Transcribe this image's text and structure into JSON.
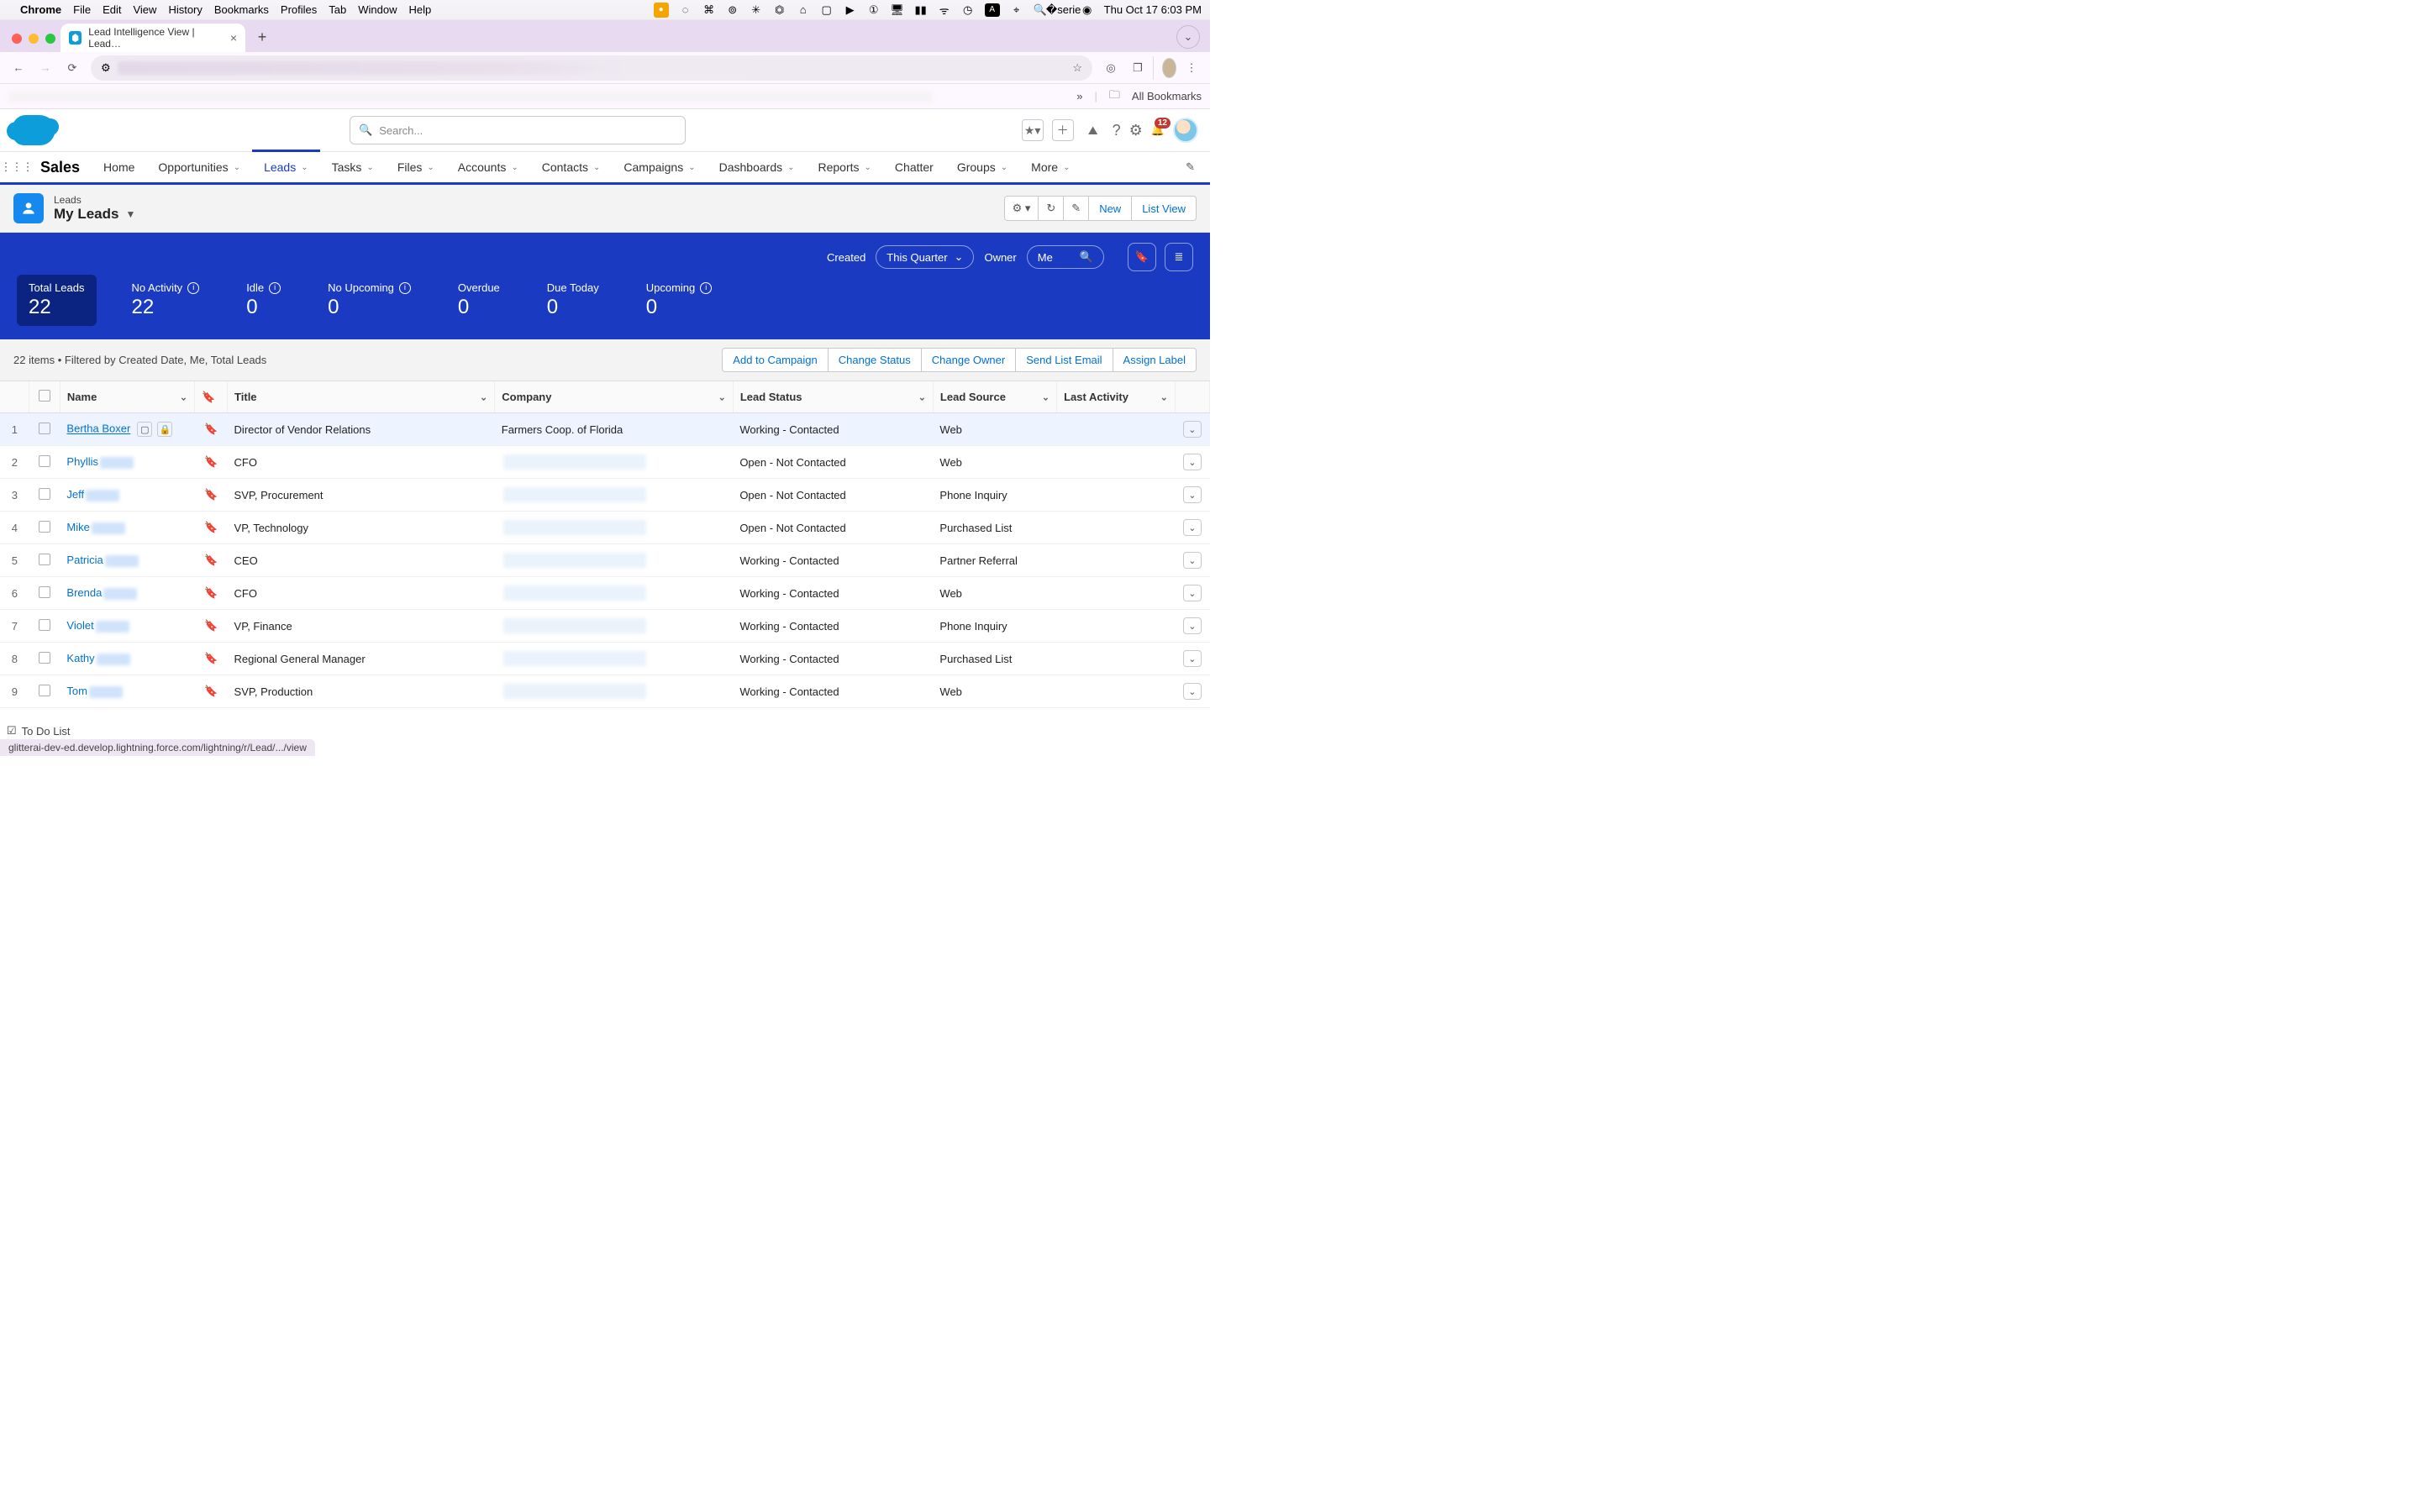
{
  "menubar": {
    "app": "Chrome",
    "items": [
      "File",
      "Edit",
      "View",
      "History",
      "Bookmarks",
      "Profiles",
      "Tab",
      "Window",
      "Help"
    ],
    "clock": "Thu Oct 17  6:03 PM"
  },
  "browser": {
    "tab_title": "Lead Intelligence View | Lead…",
    "all_bookmarks": "All Bookmarks",
    "status_url": "glitterai-dev-ed.develop.lightning.force.com/lightning/r/Lead/.../view"
  },
  "sf_header": {
    "search_placeholder": "Search...",
    "notif_count": "12"
  },
  "nav": {
    "app_name": "Sales",
    "tabs": [
      "Home",
      "Opportunities",
      "Leads",
      "Tasks",
      "Files",
      "Accounts",
      "Contacts",
      "Campaigns",
      "Dashboards",
      "Reports",
      "Chatter",
      "Groups",
      "More"
    ],
    "active": "Leads"
  },
  "page": {
    "object_label": "Leads",
    "view_name": "My Leads",
    "actions": {
      "new": "New",
      "list_view": "List View"
    }
  },
  "kpi_band": {
    "created_label": "Created",
    "created_value": "This Quarter",
    "owner_label": "Owner",
    "owner_value": "Me",
    "metrics": [
      {
        "label": "Total Leads",
        "value": "22",
        "selected": true,
        "info": false
      },
      {
        "label": "No Activity",
        "value": "22",
        "info": true
      },
      {
        "label": "Idle",
        "value": "0",
        "info": true
      },
      {
        "label": "No Upcoming",
        "value": "0",
        "info": true
      },
      {
        "label": "Overdue",
        "value": "0",
        "info": false
      },
      {
        "label": "Due Today",
        "value": "0",
        "info": false
      },
      {
        "label": "Upcoming",
        "value": "0",
        "info": true
      }
    ]
  },
  "filterbar": {
    "summary": "22 items • Filtered by Created Date, Me, Total Leads",
    "actions": [
      "Add to Campaign",
      "Change Status",
      "Change Owner",
      "Send List Email",
      "Assign Label"
    ]
  },
  "columns": [
    "Name",
    "Title",
    "Company",
    "Lead Status",
    "Lead Source",
    "Last Activity"
  ],
  "rows": [
    {
      "n": "1",
      "name": "Bertha Boxer",
      "title": "Director of Vendor Relations",
      "company": "Farmers Coop. of Florida",
      "status": "Working - Contacted",
      "source": "Web",
      "hl": true,
      "company_redact": false
    },
    {
      "n": "2",
      "name": "Phyllis",
      "title": "CFO",
      "company": "",
      "status": "Open - Not Contacted",
      "source": "Web"
    },
    {
      "n": "3",
      "name": "Jeff",
      "title": "SVP, Procurement",
      "company": "",
      "status": "Open - Not Contacted",
      "source": "Phone Inquiry"
    },
    {
      "n": "4",
      "name": "Mike",
      "title": "VP, Technology",
      "company": "",
      "status": "Open - Not Contacted",
      "source": "Purchased List"
    },
    {
      "n": "5",
      "name": "Patricia",
      "title": "CEO",
      "company": "",
      "status": "Working - Contacted",
      "source": "Partner Referral"
    },
    {
      "n": "6",
      "name": "Brenda",
      "title": "CFO",
      "company": "",
      "status": "Working - Contacted",
      "source": "Web"
    },
    {
      "n": "7",
      "name": "Violet",
      "title": "VP, Finance",
      "company": "",
      "status": "Working - Contacted",
      "source": "Phone Inquiry"
    },
    {
      "n": "8",
      "name": "Kathy",
      "title": "Regional General Manager",
      "company": "",
      "status": "Working - Contacted",
      "source": "Purchased List"
    },
    {
      "n": "9",
      "name": "Tom",
      "title": "SVP, Production",
      "company": "",
      "status": "Working - Contacted",
      "source": "Web"
    }
  ],
  "todo": "To Do List"
}
